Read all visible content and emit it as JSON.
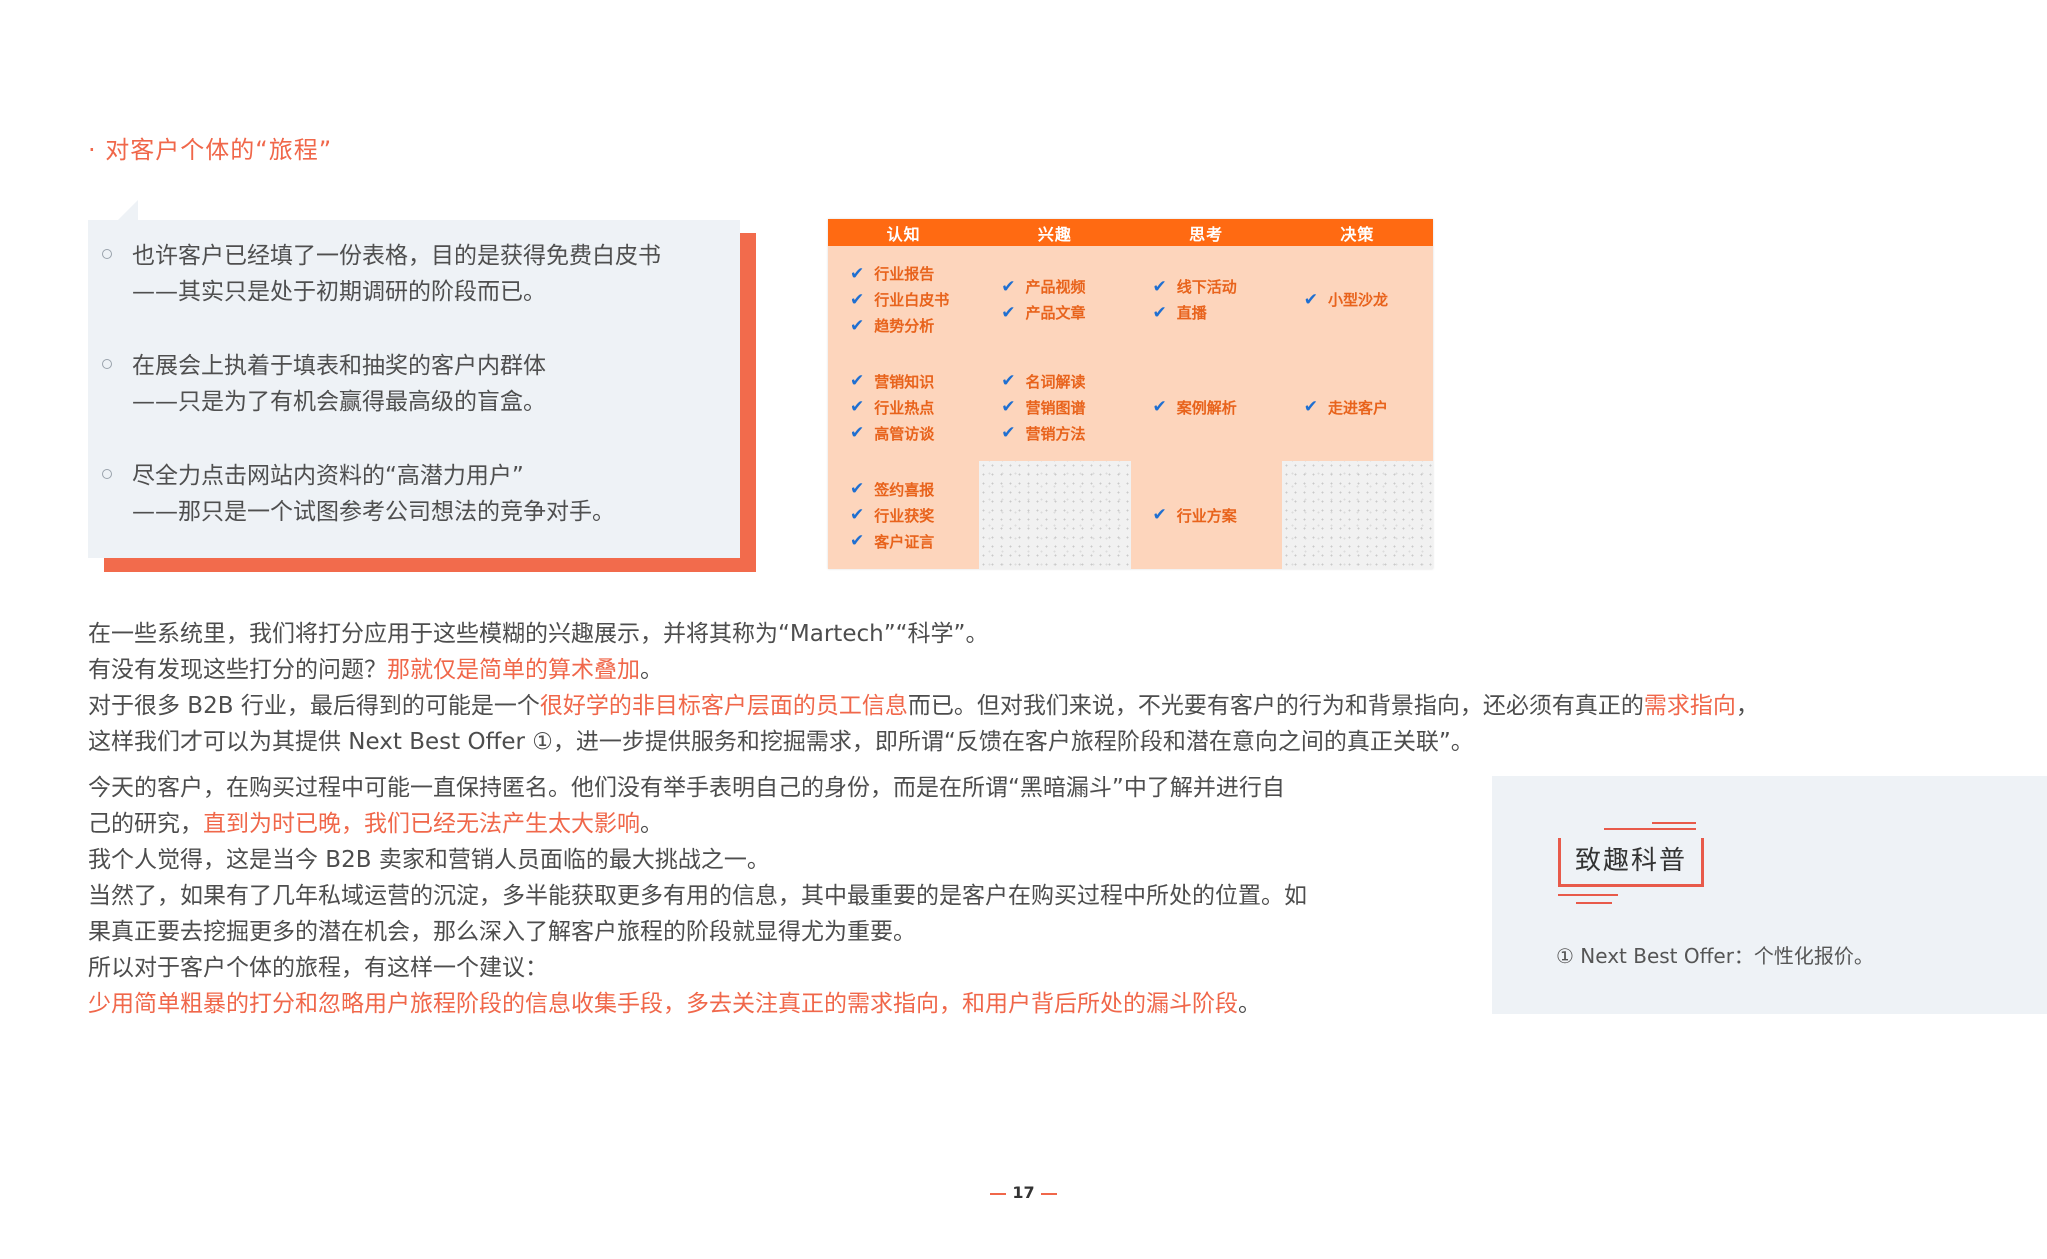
{
  "section_title": "· 对客户个体的“旅程”",
  "quotes": [
    {
      "line1": "也许客户已经填了一份表格，目的是获得免费白皮书",
      "line2": "——其实只是处于初期调研的阶段而已。"
    },
    {
      "line1": "在展会上执着于填表和抽奖的客户内群体",
      "line2": "——只是为了有机会赢得最高级的盲盒。"
    },
    {
      "line1": "尽全力点击网站内资料的“高潜力用户”",
      "line2": "——那只是一个试图参考公司想法的竞争对手。"
    }
  ],
  "matrix": {
    "headers": [
      "认知",
      "兴趣",
      "思考",
      "决策"
    ],
    "rows": [
      [
        [
          "行业报告",
          "行业白皮书",
          "趋势分析"
        ],
        [
          "产品视频",
          "产品文章"
        ],
        [
          "线下活动",
          "直播"
        ],
        [
          "小型沙龙"
        ]
      ],
      [
        [
          "营销知识",
          "行业热点",
          "高管访谈"
        ],
        [
          "名词解读",
          "营销图谱",
          "营销方法"
        ],
        [
          "案例解析"
        ],
        [
          "走进客户"
        ]
      ],
      [
        [
          "签约喜报",
          "行业获奖",
          "客户证言"
        ],
        [],
        [
          "行业方案"
        ],
        []
      ]
    ],
    "check_symbol": "✔",
    "colors": {
      "header": "#ff6a12",
      "highlight": "#fdd5bc",
      "check": "#1f6fd1",
      "item_text": "#e8631c"
    }
  },
  "para1": {
    "l1": "在一些系统里，我们将打分应用于这些模糊的兴趣展示，并将其称为“Martech”“科学”。",
    "l2a": "有没有发现这些打分的问题？",
    "l2b": "那就仅是简单的算术叠加",
    "l2c": "。",
    "l3a": "对于很多 B2B 行业，最后得到的可能是一个",
    "l3b": "很好学的非目标客户层面的员工信息",
    "l3c": "而已。但对我们来说，不光要有客户的行为和背景指向，还必须有真正的",
    "l3d": "需求指向",
    "l3e": "，",
    "l4": "这样我们才可以为其提供 Next Best Offer ①，进一步提供服务和挖掘需求，即所谓“反馈在客户旅程阶段和潜在意向之间的真正关联”。"
  },
  "para2": {
    "l1": "今天的客户，在购买过程中可能一直保持匿名。他们没有举手表明自己的身份，而是在所谓“黑暗漏斗”中了解并进行自",
    "l2a": "己的研究，",
    "l2b": "直到为时已晚，我们已经无法产生太大影响",
    "l2c": "。",
    "l3": "我个人觉得，这是当今 B2B 卖家和营销人员面临的最大挑战之一。",
    "l4": "当然了，如果有了几年私域运营的沉淀，多半能获取更多有用的信息，其中最重要的是客户在购买过程中所处的位置。如",
    "l5": "果真正要去挖掘更多的潜在机会，那么深入了解客户旅程的阶段就显得尤为重要。",
    "l6": "所以对于客户个体的旅程，有这样一个建议：",
    "l7a": "少用简单粗暴的打分和忽略用户旅程阶段的信息收集手段，多去关注真正的需求指向，和用户背后所处的漏斗阶段",
    "l7b": "。"
  },
  "note": {
    "title": "致趣科普",
    "text": "① Next Best Offer：个性化报价。"
  },
  "page_number": "17"
}
